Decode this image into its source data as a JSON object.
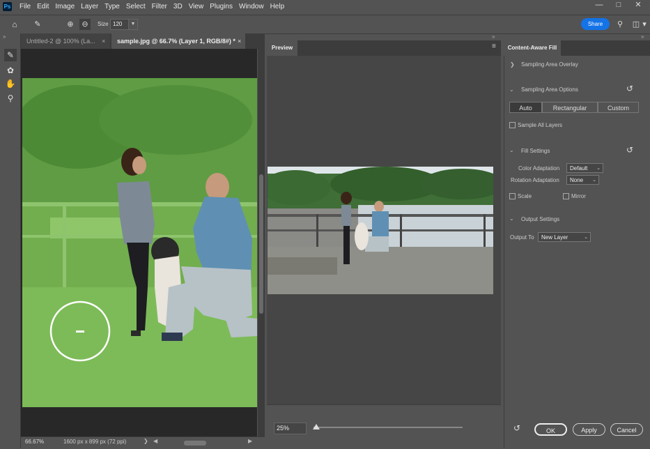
{
  "menubar": {
    "logo": "Ps",
    "items": [
      "File",
      "Edit",
      "Image",
      "Layer",
      "Type",
      "Select",
      "Filter",
      "3D",
      "View",
      "Plugins",
      "Window",
      "Help"
    ]
  },
  "options": {
    "size_label": "Size",
    "size_value": "120",
    "share_label": "Share"
  },
  "tabs": [
    {
      "label": "Untitled-2 @ 100% (La..."
    },
    {
      "label": "sample.jpg @ 66.7% (Layer 1, RGB/8#) *"
    }
  ],
  "status": {
    "zoom": "66.67%",
    "doc_info": "1600 px x 899 px (72 ppi)"
  },
  "preview": {
    "tab_label": "Preview",
    "zoom_value": "25%"
  },
  "panel": {
    "title": "Content-Aware Fill",
    "sampling_overlay": "Sampling Area Overlay",
    "sampling_options": "Sampling Area Options",
    "segments": [
      "Auto",
      "Rectangular",
      "Custom"
    ],
    "sample_all_layers": "Sample All Layers",
    "fill_settings": "Fill Settings",
    "color_adaptation_label": "Color Adaptation",
    "color_adaptation_value": "Default",
    "rotation_adaptation_label": "Rotation Adaptation",
    "rotation_adaptation_value": "None",
    "scale_label": "Scale",
    "mirror_label": "Mirror",
    "output_settings": "Output Settings",
    "output_to_label": "Output To",
    "output_to_value": "New Layer",
    "ok_label": "OK",
    "apply_label": "Apply",
    "cancel_label": "Cancel"
  },
  "colors": {
    "accent": "#1473e6",
    "mask_green": "#6fbf4a"
  }
}
